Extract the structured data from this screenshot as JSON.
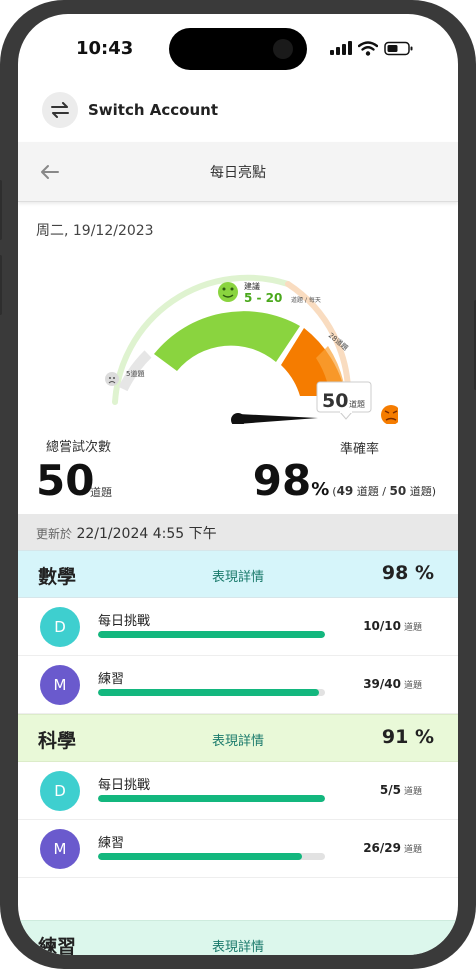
{
  "status_bar": {
    "time": "10:43"
  },
  "switch_account": {
    "label": "Switch Account"
  },
  "header": {
    "title": "每日亮點"
  },
  "date": "周二, 19/12/2023",
  "gauge": {
    "recommend_label": "建議",
    "recommend_range": "5 - 20",
    "recommend_unit": "道題 / 每天",
    "low_mark": "5道題",
    "high_mark": "28道題",
    "current_value": "50",
    "current_unit": "道題",
    "colors": {
      "green": "#8ad43f",
      "orange": "#f57c00",
      "light_orange": "#f7c28a"
    }
  },
  "totals": {
    "label": "總嘗試次數",
    "value": "50",
    "unit": "道題"
  },
  "accuracy": {
    "label": "準確率",
    "value": "98",
    "percent_sign": "%",
    "correct": "49",
    "total": "50",
    "unit": "道題",
    "sep": "/"
  },
  "updated": {
    "prefix": "更新於",
    "time": "22/1/2024 4:55 下午"
  },
  "subjects": [
    {
      "name": "數學",
      "detail_label": "表現詳情",
      "percent": "98 %",
      "bg": "#d6f5fa",
      "rows": [
        {
          "avatar": "D",
          "avatar_color": "#3ecfcf",
          "label": "每日挑戰",
          "score": "10/10",
          "unit": "道題",
          "progress": 1.0
        },
        {
          "avatar": "M",
          "avatar_color": "#6a5acd",
          "label": "練習",
          "score": "39/40",
          "unit": "道題",
          "progress": 0.975
        }
      ]
    },
    {
      "name": "科學",
      "detail_label": "表現詳情",
      "percent": "91 %",
      "bg": "#e9f9d8",
      "rows": [
        {
          "avatar": "D",
          "avatar_color": "#3ecfcf",
          "label": "每日挑戰",
          "score": "5/5",
          "unit": "道題",
          "progress": 1.0
        },
        {
          "avatar": "M",
          "avatar_color": "#6a5acd",
          "label": "練習",
          "score": "26/29",
          "unit": "道題",
          "progress": 0.897
        }
      ]
    },
    {
      "name": "練習",
      "detail_label": "表現詳情",
      "percent": "",
      "bg": "#dcf7ec",
      "rows": []
    }
  ]
}
